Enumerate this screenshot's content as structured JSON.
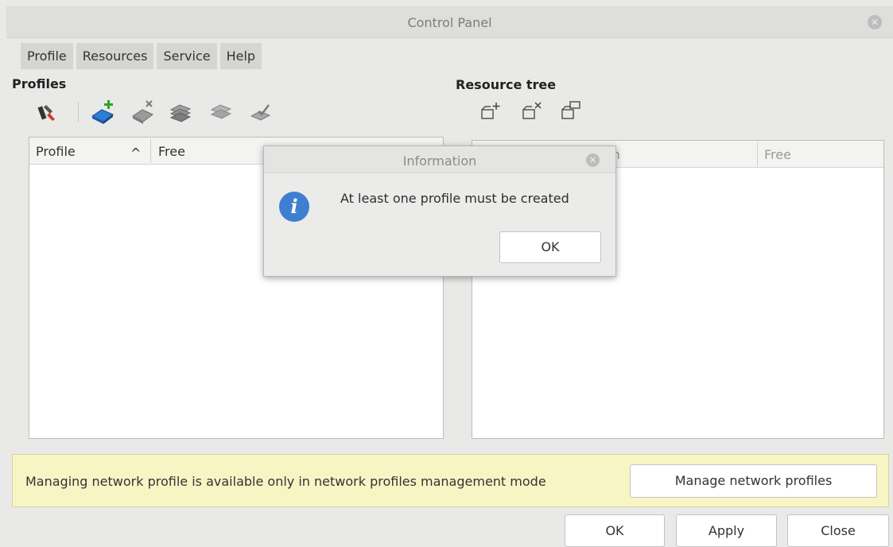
{
  "window": {
    "title": "Control Panel"
  },
  "menu": [
    {
      "label": "Profile"
    },
    {
      "label": "Resources"
    },
    {
      "label": "Service"
    },
    {
      "label": "Help"
    }
  ],
  "profiles": {
    "label": "Profiles",
    "columns": [
      {
        "label": "Profile"
      },
      {
        "label": "Free"
      }
    ],
    "sort_indicator": "^"
  },
  "resource_tree": {
    "label": "Resource tree",
    "columns": [
      {
        "label": "ith"
      },
      {
        "label": "Free"
      }
    ]
  },
  "notice": {
    "text": "Managing network profile is available only in network profiles management mode",
    "button": "Manage network profiles"
  },
  "footer": {
    "ok": "OK",
    "apply": "Apply",
    "close": "Close"
  },
  "dialog": {
    "title": "Information",
    "message": "At least one profile must be created",
    "ok": "OK"
  },
  "colors": {
    "info_blue": "#3f7fd1",
    "notice_yellow": "#f8f5c5",
    "toolbar_blue": "#2a7fd4",
    "add_green": "#2aa52a"
  }
}
